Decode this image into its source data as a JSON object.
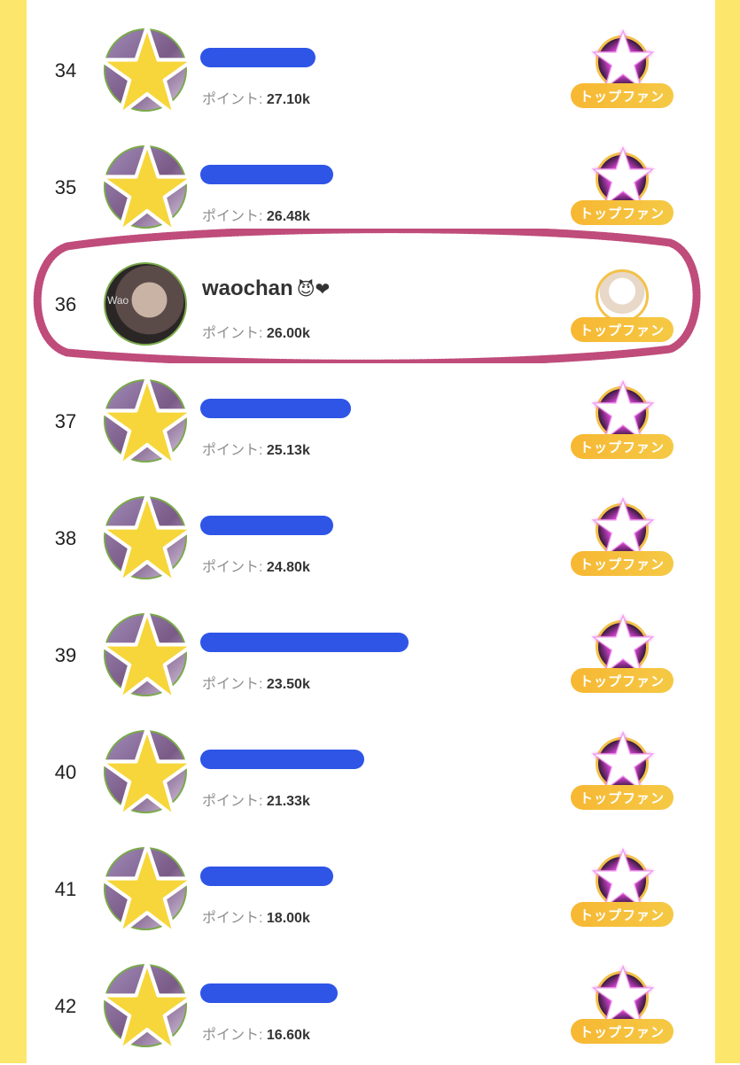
{
  "ranking": {
    "points_label": "ポイント: ",
    "badge_label": "トップファン",
    "rows": [
      {
        "rank": "34",
        "name": "",
        "points": "27.10k",
        "redact_width": 130
      },
      {
        "rank": "35",
        "name": "",
        "points": "26.48k",
        "redact_width": 150
      },
      {
        "rank": "36",
        "name": "waochan",
        "points": "26.00k",
        "redact_width": 0,
        "name_icons": "😈❤",
        "avatar_watermark": "Wao"
      },
      {
        "rank": "37",
        "name": "",
        "points": "25.13k",
        "redact_width": 170
      },
      {
        "rank": "38",
        "name": "",
        "points": "24.80k",
        "redact_width": 150
      },
      {
        "rank": "39",
        "name": "",
        "points": "23.50k",
        "redact_width": 235
      },
      {
        "rank": "40",
        "name": "",
        "points": "21.33k",
        "redact_width": 185
      },
      {
        "rank": "41",
        "name": "",
        "points": "18.00k",
        "redact_width": 150
      },
      {
        "rank": "42",
        "name": "",
        "points": "16.60k",
        "redact_width": 155
      }
    ]
  },
  "colors": {
    "side_bar": "#fde66c",
    "badge": "#f7b733",
    "highlight_scribble": "#b8396b",
    "redaction": "#2e55e6",
    "star_fill": "#f6d63a"
  },
  "icons": {
    "avatar_overlay": "yellow-star-icon",
    "fan_overlay": "white-glow-star-icon"
  }
}
